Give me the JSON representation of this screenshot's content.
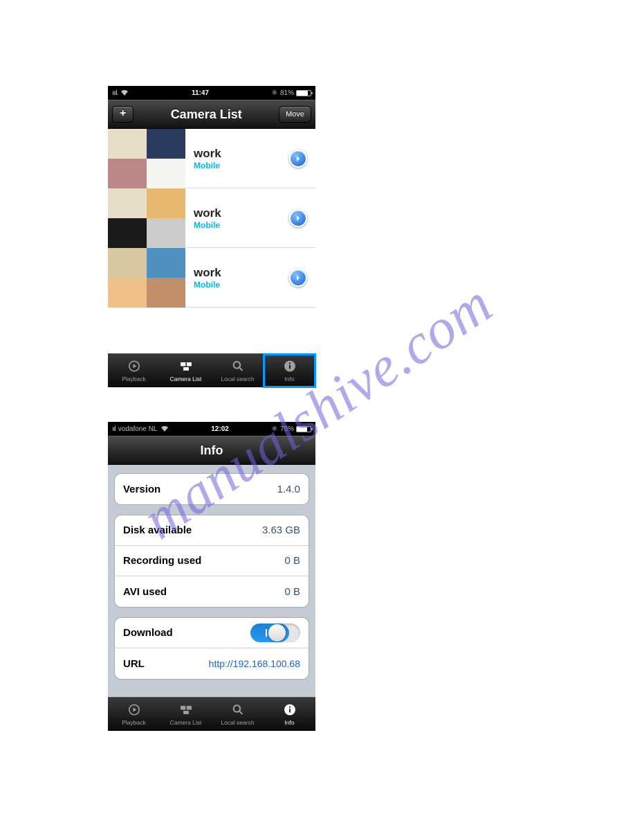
{
  "watermark": "manualshive.com",
  "screen1": {
    "status": {
      "carrier_bars": "ıııl.",
      "wifi": "▲",
      "time": "11:47",
      "bt": "✱",
      "battery_pct": "81%",
      "battery_fill": 81
    },
    "nav": {
      "add": "+",
      "title": "Camera List",
      "move": "Move"
    },
    "items": [
      {
        "name": "work",
        "sub": "Mobile",
        "thumb": "t1"
      },
      {
        "name": "work",
        "sub": "Mobile",
        "thumb": "t2"
      },
      {
        "name": "work",
        "sub": "Mobile",
        "thumb": "t3"
      }
    ],
    "tabs": [
      "Playback",
      "Camera List",
      "Local search",
      "Info"
    ],
    "active_tab": 1,
    "highlight_tab": 3
  },
  "screen2": {
    "status": {
      "carrier_bars": "ııl",
      "carrier": "vodafone NL",
      "time": "12:02",
      "bt": "✱",
      "battery_pct": "75%",
      "battery_fill": 75
    },
    "nav": {
      "title": "Info"
    },
    "groups": [
      {
        "rows": [
          {
            "k": "Version",
            "v": "1.4.0"
          }
        ]
      },
      {
        "rows": [
          {
            "k": "Disk available",
            "v": "3.63 GB"
          },
          {
            "k": "Recording used",
            "v": "0 B"
          },
          {
            "k": "AVI used",
            "v": "0 B"
          }
        ]
      },
      {
        "rows": [
          {
            "k": "Download",
            "toggle": true
          },
          {
            "k": "URL",
            "link": "http://192.168.100.68"
          }
        ]
      }
    ],
    "tabs": [
      "Playback",
      "Camera List",
      "Local search",
      "Info"
    ],
    "active_tab": 3
  }
}
